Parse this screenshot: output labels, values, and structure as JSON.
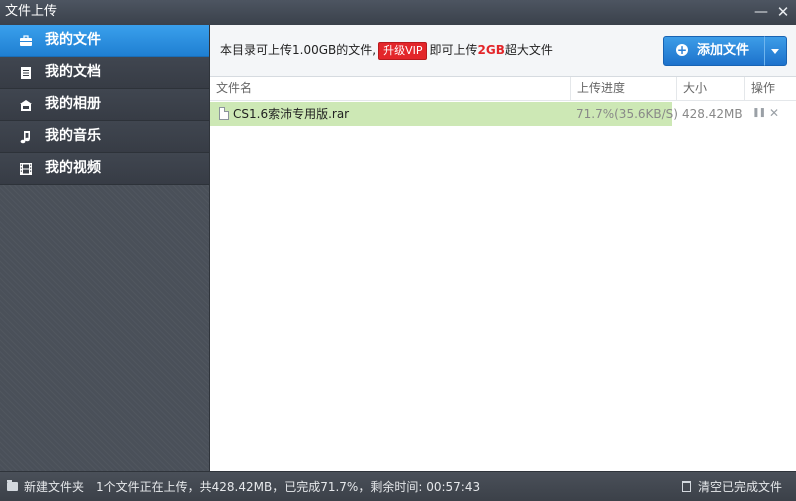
{
  "window": {
    "title": "文件上传",
    "minimize_glyph": "—",
    "close_glyph": "✕"
  },
  "sidebar": {
    "items": [
      {
        "label": "我的文件",
        "icon": "briefcase-icon",
        "active": true
      },
      {
        "label": "我的文档",
        "icon": "document-icon",
        "active": false
      },
      {
        "label": "我的相册",
        "icon": "photo-album-icon",
        "active": false
      },
      {
        "label": "我的音乐",
        "icon": "music-note-icon",
        "active": false
      },
      {
        "label": "我的视频",
        "icon": "film-icon",
        "active": false
      }
    ]
  },
  "infobar": {
    "text_before": "本目录可上传1.00GB的文件,",
    "vip_label": "升级VIP",
    "text_middle": "即可上传",
    "highlight": "2GB",
    "text_after": "超大文件",
    "upload_button_label": "添加文件",
    "upload_plus_glyph": "+"
  },
  "table": {
    "columns": [
      "文件名",
      "上传进度",
      "大小",
      "操作"
    ],
    "rows": [
      {
        "name": "CS1.6索沛专用版.rar",
        "progress_text": "71.7%(35.6KB/S)",
        "progress_fraction": 0.717,
        "size": "428.42MB",
        "pause_glyph": "❚❚",
        "cancel_glyph": "✕"
      }
    ]
  },
  "statusbar": {
    "new_folder_label": "新建文件夹",
    "status_text": "1个文件正在上传，共428.42MB，已完成71.7%，剩余时间: 00:57:43",
    "clear_done_label": "清空已完成文件"
  },
  "colors": {
    "accent": "#1f7fd2",
    "progress": "#cde8b5",
    "vip": "#e3262a",
    "sidebar": "#4a5059"
  }
}
